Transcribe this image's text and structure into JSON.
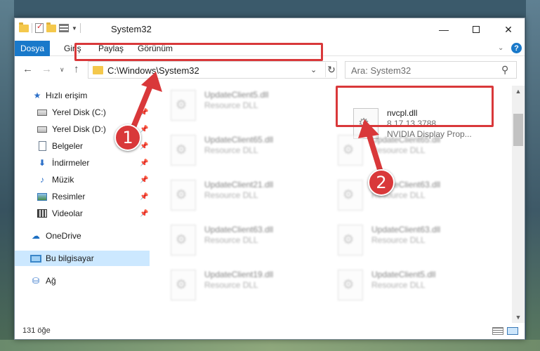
{
  "window": {
    "title": "System32",
    "controls": {
      "minimize": "—",
      "maximize": "",
      "close": "✕"
    }
  },
  "ribbon": {
    "file_tab": "Dosya",
    "tabs": [
      "Giriş",
      "Paylaş",
      "Görünüm"
    ],
    "help": "?"
  },
  "navigation": {
    "address_path": "C:\\Windows\\System32",
    "search_placeholder": "Ara: System32"
  },
  "sidebar": {
    "items": [
      {
        "label": "Hızlı erişim",
        "icon": "star-icon"
      },
      {
        "label": "Yerel Disk (C:)",
        "icon": "drive-icon",
        "pinned": true
      },
      {
        "label": "Yerel Disk (D:)",
        "icon": "drive-icon",
        "pinned": true
      },
      {
        "label": "Belgeler",
        "icon": "documents-icon",
        "pinned": true
      },
      {
        "label": "İndirmeler",
        "icon": "downloads-icon",
        "pinned": true
      },
      {
        "label": "Müzik",
        "icon": "music-icon",
        "pinned": true
      },
      {
        "label": "Resimler",
        "icon": "pictures-icon",
        "pinned": true
      },
      {
        "label": "Videolar",
        "icon": "videos-icon",
        "pinned": true
      },
      {
        "label": "OneDrive",
        "icon": "cloud-icon"
      },
      {
        "label": "Bu bilgisayar",
        "icon": "computer-icon",
        "selected": true
      },
      {
        "label": "Ağ",
        "icon": "network-icon"
      }
    ]
  },
  "files": {
    "highlighted": {
      "name": "nvcpl.dll",
      "version": "8.17.13.3788",
      "description": "NVIDIA Display Prop..."
    },
    "left_column": [
      {
        "name": "UpdateClient5.dll",
        "type": "Resource DLL"
      },
      {
        "name": "UpdateClient65.dll",
        "type": "Resource DLL"
      },
      {
        "name": "UpdateClient21.dll",
        "type": "Resource DLL"
      },
      {
        "name": "UpdateClient63.dll",
        "type": "Resource DLL"
      },
      {
        "name": "UpdateClient19.dll",
        "type": "Resource DLL"
      }
    ],
    "right_column": [
      {
        "name": "UpdateClient65.dll",
        "type": "Resource DLL"
      },
      {
        "name": "UpdateClient63.dll",
        "type": "Resource DLL"
      },
      {
        "name": "UpdateClient63.dll",
        "type": "Resource DLL"
      },
      {
        "name": "UpdateClient5.dll",
        "type": "Resource DLL"
      }
    ]
  },
  "status": {
    "item_count": "131 öğe"
  },
  "annotations": {
    "step1": "1",
    "step2": "2",
    "highlight_color": "#d9383a"
  },
  "colors": {
    "accent": "#1979ca",
    "selection": "#cce8ff"
  }
}
